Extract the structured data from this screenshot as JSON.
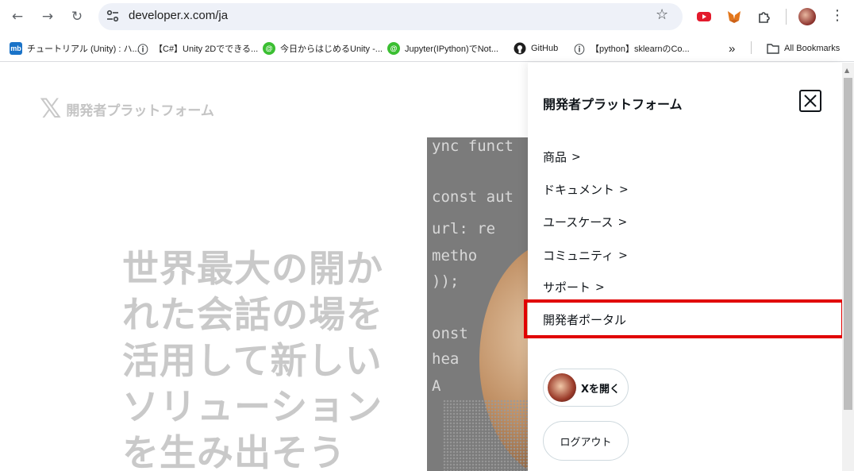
{
  "browser": {
    "url": "developer.x.com/ja",
    "bookmarks": [
      {
        "label": "チュートリアル (Unity) : ハ...",
        "icon": "mb"
      },
      {
        "label": "【C#】Unity 2Dでできる...",
        "icon": "ⓘ"
      },
      {
        "label": "今日からはじめるUnity -...",
        "icon": "@"
      },
      {
        "label": "Jupyter(IPython)でNot...",
        "icon": "@"
      },
      {
        "label": "GitHub",
        "icon": "gh"
      },
      {
        "label": "【python】sklearnのCo...",
        "icon": "ⓘ"
      }
    ],
    "more_bookmarks": "»",
    "all_bookmarks": "All Bookmarks"
  },
  "page": {
    "logo_text": "開発者プラットフォーム",
    "hero_lines": [
      "世界最大の開か",
      "れた会話の場を",
      "活用して新しい",
      "ソリューション",
      "を生み出そう"
    ],
    "code_lines": [
      "ync funct",
      "const aut",
      "  url: re",
      "  metho",
      "));",
      "onst",
      " hea",
      "  A"
    ]
  },
  "drawer": {
    "title": "開発者プラットフォーム",
    "items": [
      {
        "label": "商品",
        "chevron": ">"
      },
      {
        "label": "ドキュメント",
        "chevron": ">"
      },
      {
        "label": "ユースケース",
        "chevron": ">"
      },
      {
        "label": "コミュニティ",
        "chevron": ">"
      },
      {
        "label": "サポート",
        "chevron": ">"
      },
      {
        "label": "開発者ポータル",
        "chevron": ""
      }
    ],
    "open_x": "Xを開く",
    "logout": "ログアウト"
  },
  "colors": {
    "highlight": "#e10000",
    "text": "#0f1419"
  }
}
